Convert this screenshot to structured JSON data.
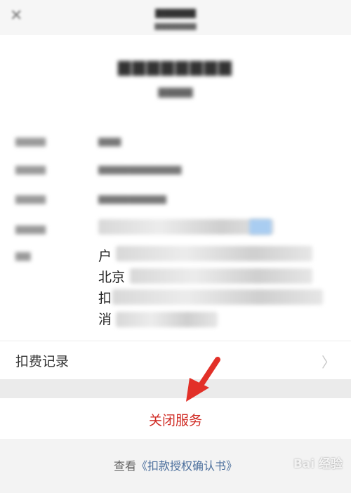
{
  "colors": {
    "accent_red": "#d02c25",
    "arrow_red": "#e23028",
    "link": "#4a6e9c"
  },
  "icons": {
    "close": "close-icon",
    "chevron": "chevron-right-icon",
    "arrow": "red-arrow-icon"
  },
  "details": {
    "line_starts": [
      "户",
      "北京",
      "扣",
      "消"
    ]
  },
  "deduction_record": {
    "label": "扣费记录"
  },
  "close_service": {
    "label": "关闭服务"
  },
  "footer": {
    "prefix": "查看",
    "link": "《扣款授权确认书》"
  },
  "watermark": {
    "text": "Bai 经验"
  }
}
